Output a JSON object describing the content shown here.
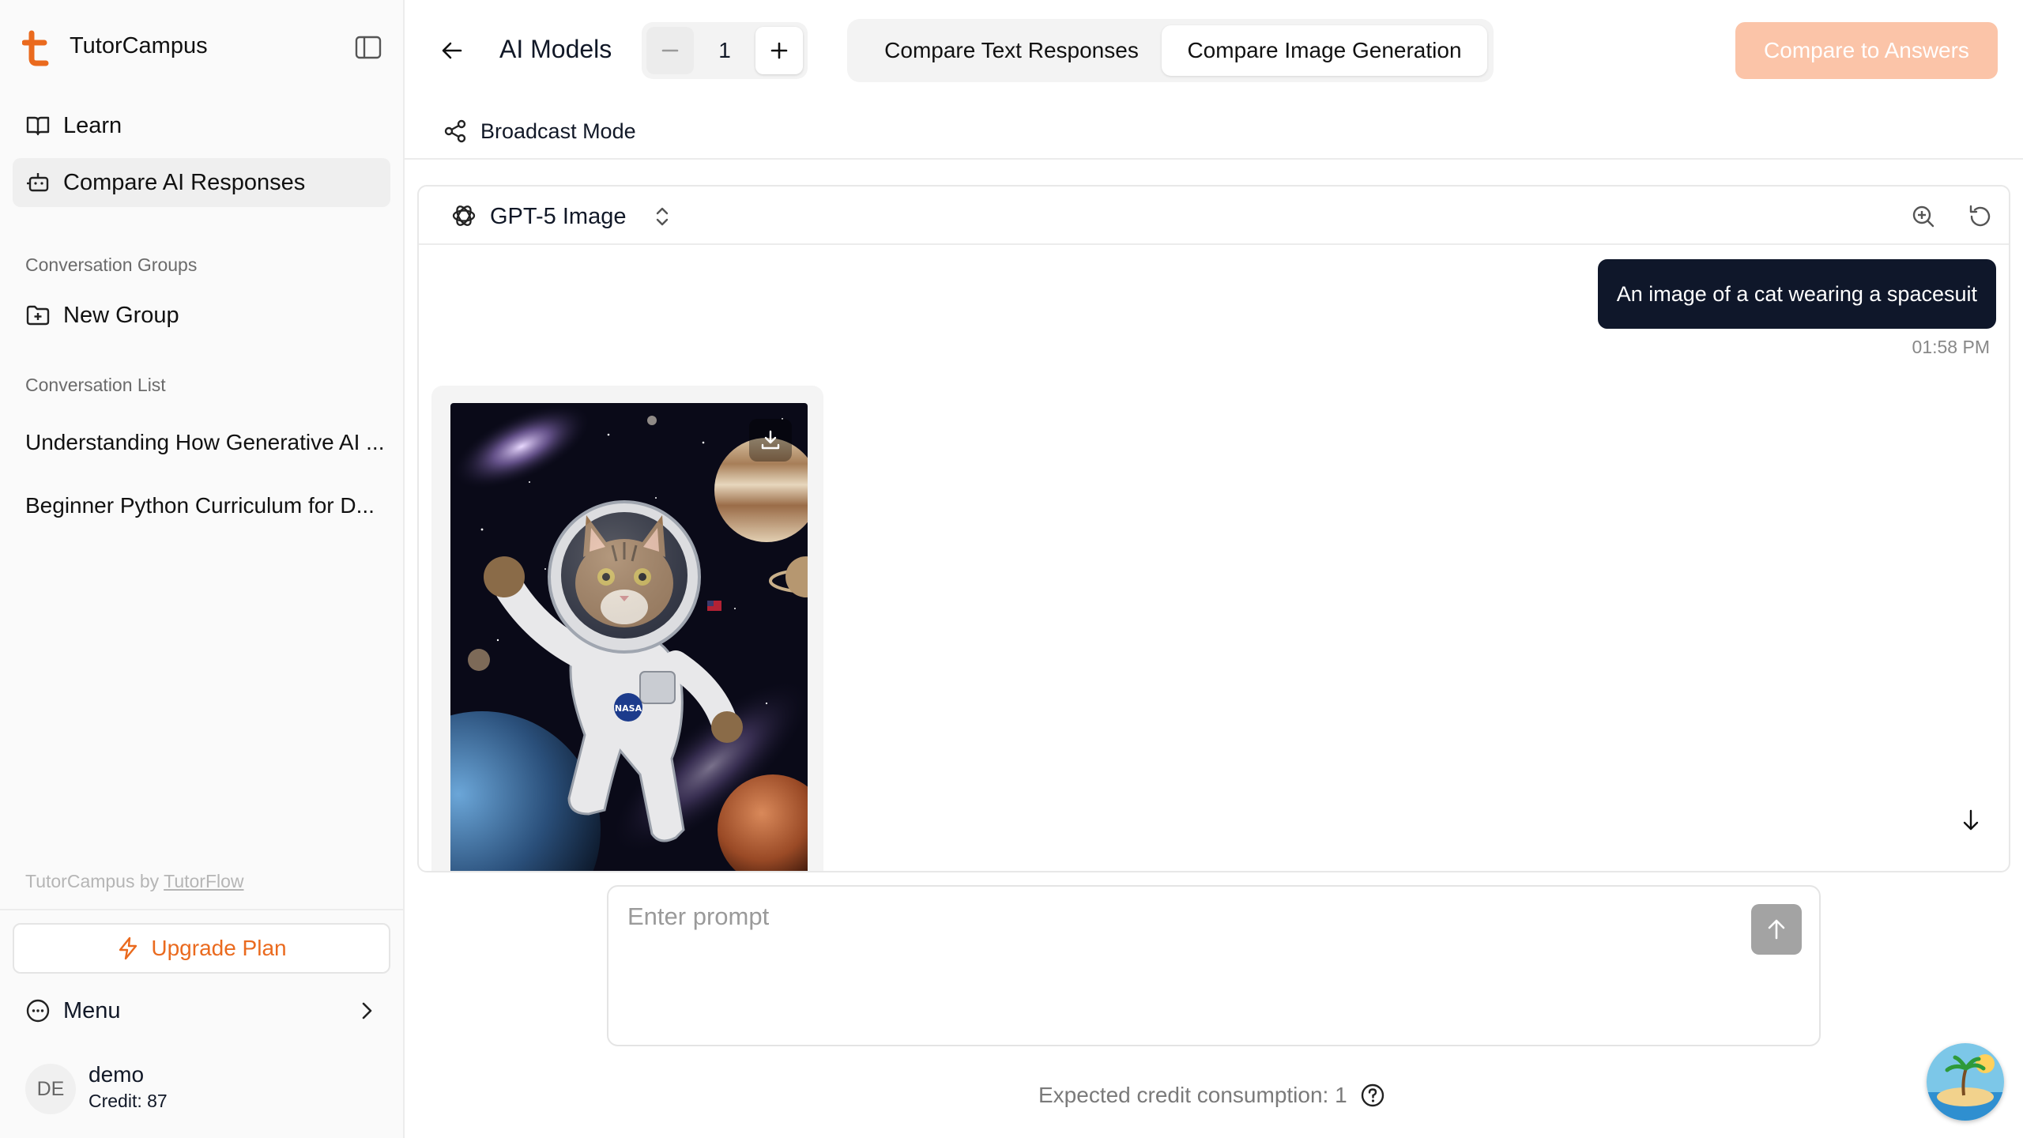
{
  "app": {
    "name": "TutorCampus",
    "brand_color": "#ea6a1e"
  },
  "sidebar": {
    "nav": [
      {
        "label": "Learn",
        "icon": "book-open-icon"
      },
      {
        "label": "Compare AI Responses",
        "icon": "bot-icon",
        "active": true
      }
    ],
    "groups_heading": "Conversation Groups",
    "new_group_label": "New Group",
    "list_heading": "Conversation List",
    "conversations": [
      "Understanding How Generative AI ...",
      "Beginner Python Curriculum for D..."
    ],
    "footer_prefix": "TutorCampus by ",
    "footer_link": "TutorFlow",
    "upgrade_label": "Upgrade Plan",
    "menu_label": "Menu",
    "user": {
      "initials": "DE",
      "name": "demo",
      "credit": "Credit: 87"
    }
  },
  "header": {
    "title": "AI Models",
    "model_count": "1",
    "tabs": [
      "Compare Text Responses",
      "Compare Image Generation"
    ],
    "active_tab": "Compare Image Generation",
    "compare_button": "Compare to Answers",
    "broadcast_label": "Broadcast Mode"
  },
  "panel": {
    "model_name": "GPT-5 Image",
    "user_message": "An image of a cat wearing a spacesuit",
    "message_time": "01:58 PM",
    "image_subject": "cat-astronaut-in-space",
    "badge_text": "NASA"
  },
  "prompt": {
    "placeholder": "Enter prompt",
    "credit_text": "Expected credit consumption: 1"
  }
}
